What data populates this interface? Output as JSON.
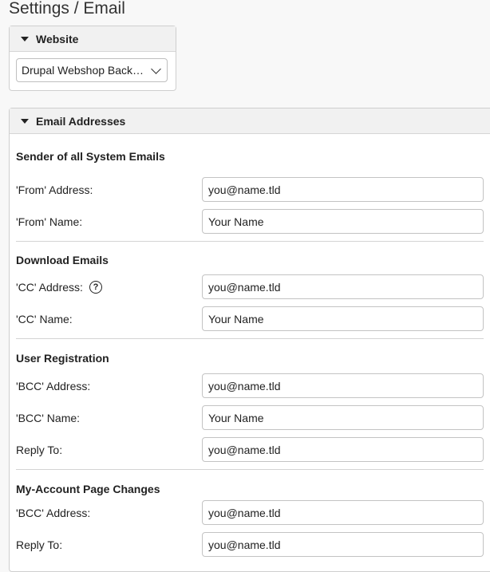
{
  "page": {
    "title": "Settings / Email"
  },
  "website_panel": {
    "header": "Website",
    "selected": "Drupal Webshop Backend"
  },
  "email_panel": {
    "header": "Email Addresses",
    "sections": {
      "system": {
        "title": "Sender of all System Emails",
        "from_address_label": "'From' Address:",
        "from_address_value": "you@name.tld",
        "from_name_label": "'From' Name:",
        "from_name_value": "Your Name"
      },
      "download": {
        "title": "Download Emails",
        "cc_address_label": "'CC' Address:",
        "cc_address_value": "you@name.tld",
        "cc_name_label": "'CC' Name:",
        "cc_name_value": "Your Name"
      },
      "registration": {
        "title": "User Registration",
        "bcc_address_label": "'BCC' Address:",
        "bcc_address_value": "you@name.tld",
        "bcc_name_label": "'BCC' Name:",
        "bcc_name_value": "Your Name",
        "reply_to_label": "Reply To:",
        "reply_to_value": "you@name.tld"
      },
      "myaccount": {
        "title": "My-Account Page Changes",
        "bcc_address_label": "'BCC' Address:",
        "bcc_address_value": "you@name.tld",
        "reply_to_label": "Reply To:",
        "reply_to_value": "you@name.tld"
      }
    }
  },
  "icons": {
    "help": "question-circle-icon",
    "caret": "caret-down-icon",
    "chevron": "chevron-down-icon"
  }
}
